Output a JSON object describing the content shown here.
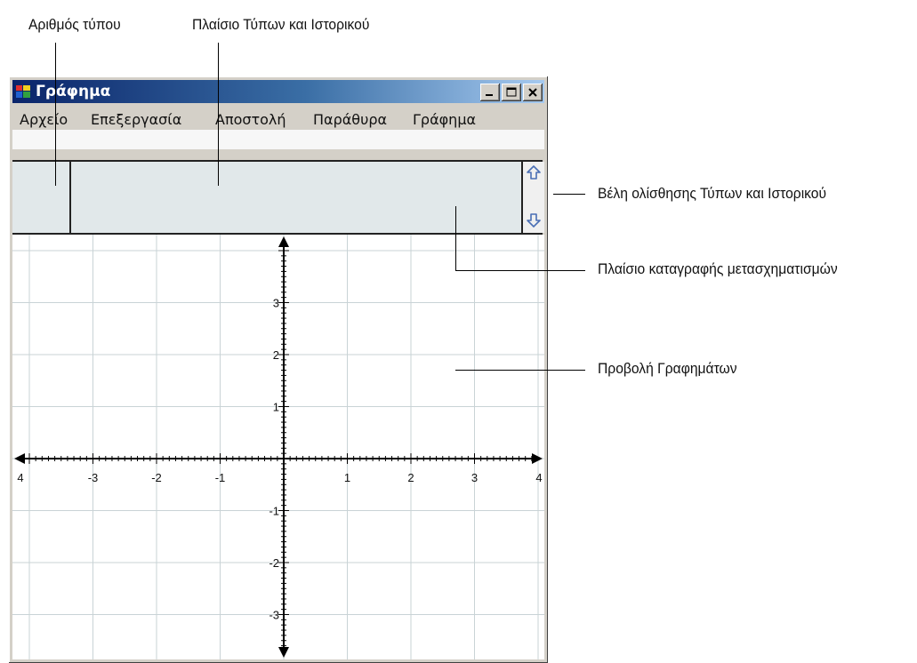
{
  "annotations": {
    "formula_number": "Αριθμός τύπου",
    "formula_history_panel": "Πλαίσιο Τύπων και Ιστορικού",
    "scroll_arrows": "Βέλη ολίσθησης Τύπων και Ιστορικού",
    "transform_panel": "Πλαίσιο καταγραφής μετασχηματισμών",
    "graph_view": "Προβολή Γραφημάτων"
  },
  "window": {
    "title": "Γράφημα",
    "controls": [
      "minimize-icon",
      "maximize-icon",
      "close-icon"
    ]
  },
  "menu": [
    "Αρχείο",
    "Επεξεργασία",
    "Αποστολή",
    "Παράθυρα",
    "Γράφημα"
  ],
  "graph": {
    "x_range": [
      -4,
      4
    ],
    "y_range": [
      -4,
      4
    ],
    "x_tick_labels": [
      "4",
      "-3",
      "-2",
      "-1",
      "1",
      "2",
      "3",
      "4"
    ],
    "y_tick_labels": [
      "3",
      "2",
      "1",
      "-1",
      "-2",
      "-3"
    ],
    "grid": true,
    "grid_color": "#c9d3d6"
  },
  "colors": {
    "titlebar_start": "#0a246a",
    "titlebar_end": "#a6caf0",
    "panel_bg": "#e1e8ea",
    "scroll_arrow": "#4a6fb5"
  }
}
